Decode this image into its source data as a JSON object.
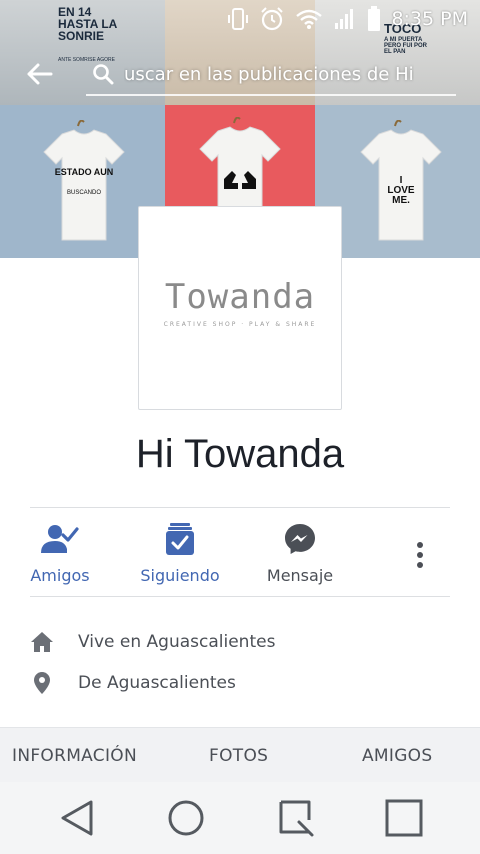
{
  "status_bar": {
    "time": "8:35 PM",
    "icons": [
      "vibrate-icon",
      "alarm-icon",
      "wifi-icon",
      "signal-icon",
      "battery-icon"
    ]
  },
  "search": {
    "text": "uscar en las publicaciones de Hi"
  },
  "cover": {
    "top_shirts": [
      {
        "text": "EN 14 HASTA LA SONRIE",
        "subtext": "ANTE SOMRISE AGORE"
      },
      {
        "text": ""
      },
      {
        "text": "TOCO",
        "subtext": "A MI PUERTA PERO FUI POR EL PAN"
      }
    ],
    "shirts": [
      {
        "text": "ESTADO AUN",
        "subtext": "BUSCANDO",
        "background": "#9fb6cb"
      },
      {
        "text": "",
        "graphic": "hands-heart",
        "background": "#e85a5e"
      },
      {
        "text": "I LOVE ME.",
        "background": "#a8bccd"
      }
    ]
  },
  "profile": {
    "logo_text": "Towanda",
    "logo_tagline": "CREATIVE SHOP · PLAY & SHARE",
    "name": "Hi Towanda"
  },
  "actions": [
    {
      "label": "Amigos",
      "icon": "friend-check-icon",
      "active": true
    },
    {
      "label": "Siguiendo",
      "icon": "following-icon",
      "active": true
    },
    {
      "label": "Mensaje",
      "icon": "messenger-icon",
      "active": false
    },
    {
      "label": "",
      "icon": "more-vertical-icon",
      "active": false
    }
  ],
  "intro": [
    {
      "icon": "home-icon",
      "text": "Vive en Aguascalientes"
    },
    {
      "icon": "location-pin-icon",
      "text": "De Aguascalientes"
    }
  ],
  "tabs": [
    "INFORMACIÓN",
    "FOTOS",
    "AMIGOS"
  ],
  "nav_bar": [
    "back-triangle-icon",
    "home-circle-icon",
    "recents-icon",
    "square-icon"
  ],
  "colors": {
    "accent": "#4267b2",
    "text_primary": "#1d2129",
    "text_secondary": "#4b4f56",
    "cover_red": "#e85a5e",
    "cover_blue": "#9fb6cb"
  }
}
